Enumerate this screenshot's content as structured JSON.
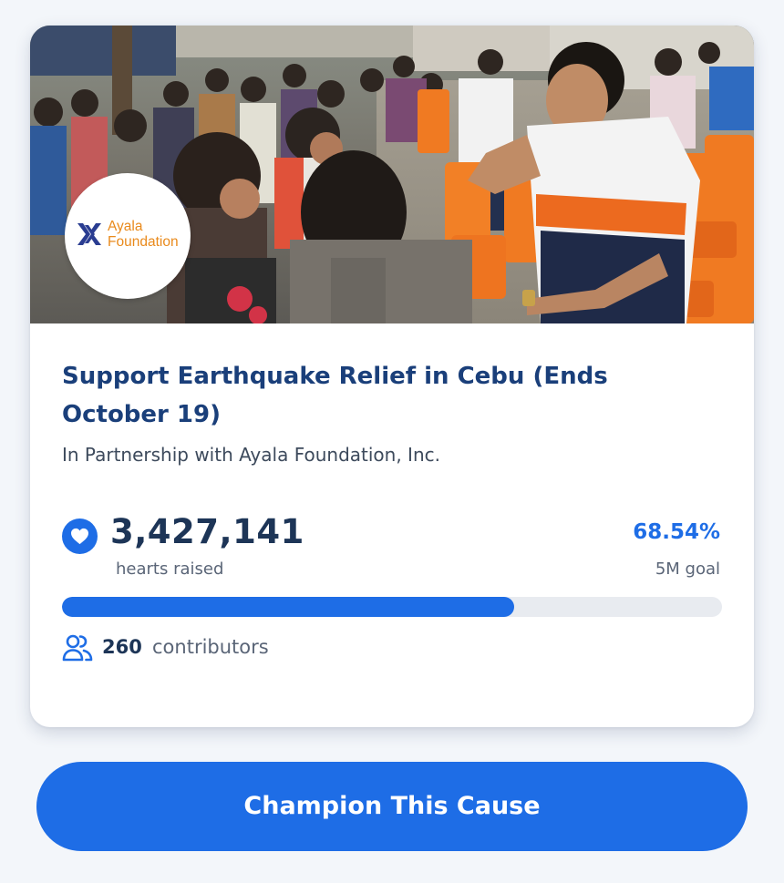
{
  "cause": {
    "partner_logo_text": "Ayala Foundation",
    "partner_logo_lines": [
      "Ayala",
      "Foundation"
    ],
    "title": "Support Earthquake Relief in Cebu (Ends October 19)",
    "subtitle": "In Partnership with Ayala Foundation, Inc."
  },
  "stats": {
    "hearts_value": "3,427,141",
    "hearts_label": "hearts raised",
    "percent": "68.54%",
    "progress_fraction": 0.6854,
    "goal": "5M goal",
    "contributors_count": "260",
    "contributors_label": "contributors"
  },
  "action": {
    "button_label": "Champion This Cause"
  },
  "colors": {
    "accent": "#1e6de6",
    "title": "#1a3f7a",
    "logo_orange": "#e98a1c",
    "logo_blue": "#2a3d91"
  },
  "icons": {
    "hearts": "heart-icon",
    "contributors": "users-icon",
    "logo": "ayala-logo-icon"
  }
}
